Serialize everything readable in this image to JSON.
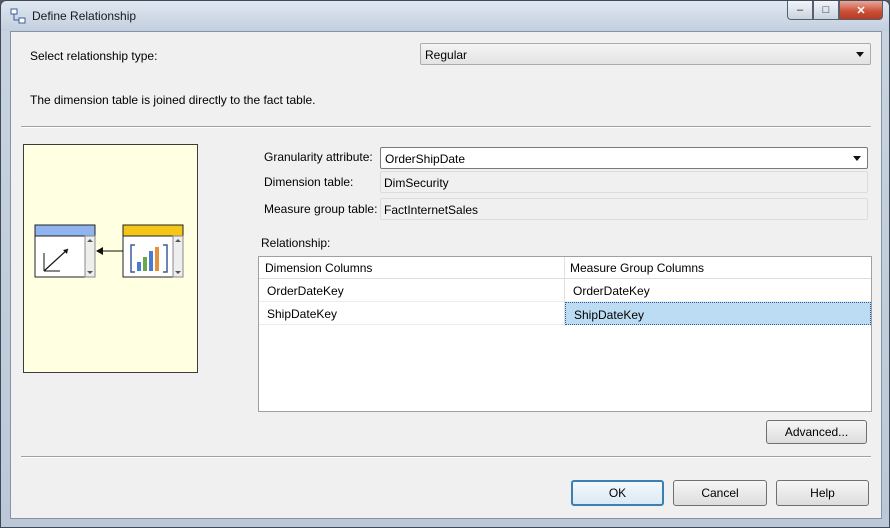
{
  "window": {
    "title": "Define Relationship",
    "icon": "relationship-icon",
    "controls": {
      "minimize": "–",
      "maximize": "□",
      "close": "✕"
    }
  },
  "relationship_type": {
    "label": "Select relationship type:",
    "value": "Regular",
    "description": "The dimension table is joined directly to the fact table."
  },
  "granularity": {
    "label": "Granularity attribute:",
    "value": "OrderShipDate"
  },
  "dimension_table": {
    "label": "Dimension table:",
    "value": "DimSecurity"
  },
  "measure_group_table": {
    "label": "Measure group table:",
    "value": "FactInternetSales"
  },
  "relationship": {
    "label": "Relationship:",
    "columns": [
      "Dimension Columns",
      "Measure Group Columns"
    ],
    "rows": [
      {
        "dimension": "OrderDateKey",
        "measure": "OrderDateKey"
      },
      {
        "dimension": "ShipDateKey",
        "measure": "ShipDateKey"
      }
    ]
  },
  "buttons": {
    "advanced": "Advanced...",
    "ok": "OK",
    "cancel": "Cancel",
    "help": "Help"
  },
  "colors": {
    "diagram_bg": "#ffffe1",
    "dimension_header": "#8fb4f0",
    "fact_header": "#f5c518",
    "selection": "#bcdcf4"
  }
}
